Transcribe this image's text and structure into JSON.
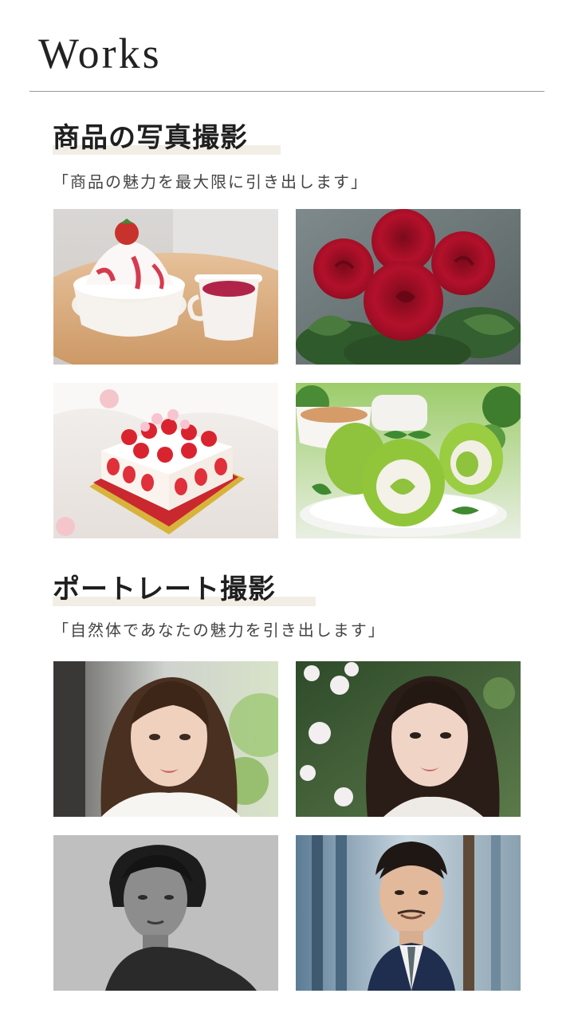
{
  "header": {
    "title": "Works"
  },
  "sections": [
    {
      "heading": "商品の写真撮影",
      "subtitle": "「商品の魅力を最大限に引き出します」",
      "photos": [
        {
          "subject": "strawberry-shaved-ice"
        },
        {
          "subject": "red-roses"
        },
        {
          "subject": "strawberry-shortcake"
        },
        {
          "subject": "matcha-roll-cake"
        }
      ]
    },
    {
      "heading": "ポートレート撮影",
      "subtitle": "「自然体であなたの魅力を引き出します」",
      "photos": [
        {
          "subject": "portrait-woman-sunlight"
        },
        {
          "subject": "portrait-woman-flowers"
        },
        {
          "subject": "portrait-man-monochrome"
        },
        {
          "subject": "portrait-man-suit"
        }
      ]
    }
  ],
  "colors": {
    "accent_highlight": "#f2eee6",
    "divider": "#9a9a9a",
    "text": "#2b2b2b"
  }
}
